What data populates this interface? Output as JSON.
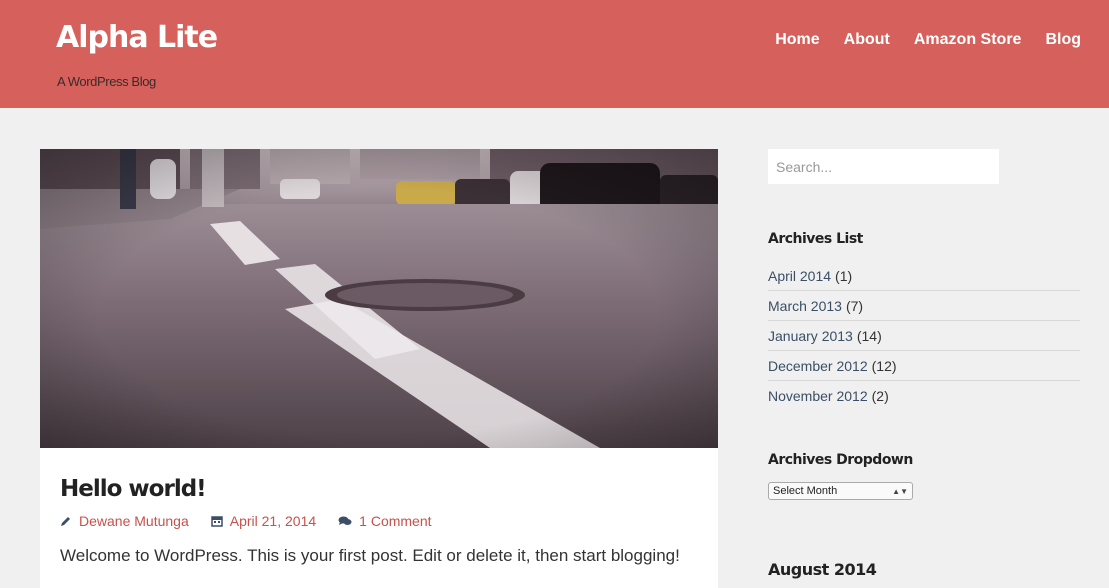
{
  "header": {
    "site_title": "Alpha Lite",
    "tagline": "A WordPress Blog",
    "nav": [
      {
        "label": "Home"
      },
      {
        "label": "About"
      },
      {
        "label": "Amazon Store"
      },
      {
        "label": "Blog"
      }
    ],
    "background_color": "#d6615c"
  },
  "post": {
    "title": "Hello world!",
    "author": "Dewane Mutunga",
    "date": "April 21, 2014",
    "comments": "1 Comment",
    "excerpt": "Welcome to WordPress. This is your first post. Edit or delete it, then start blogging!",
    "icons": [
      "pencil-icon",
      "calendar-icon",
      "comments-icon"
    ],
    "link_color": "#c9504b"
  },
  "sidebar": {
    "search": {
      "placeholder": "Search..."
    },
    "archives_list": {
      "title": "Archives List",
      "items": [
        {
          "label": "April 2014",
          "count": "(1)"
        },
        {
          "label": "March 2013",
          "count": "(7)"
        },
        {
          "label": "January 2013",
          "count": "(14)"
        },
        {
          "label": "December 2012",
          "count": "(12)"
        },
        {
          "label": "November 2012",
          "count": "(2)"
        }
      ]
    },
    "archives_dropdown": {
      "title": "Archives Dropdown",
      "selected": "Select Month"
    },
    "calendar": {
      "title": "August 2014"
    },
    "link_color": "#3a4f66"
  }
}
